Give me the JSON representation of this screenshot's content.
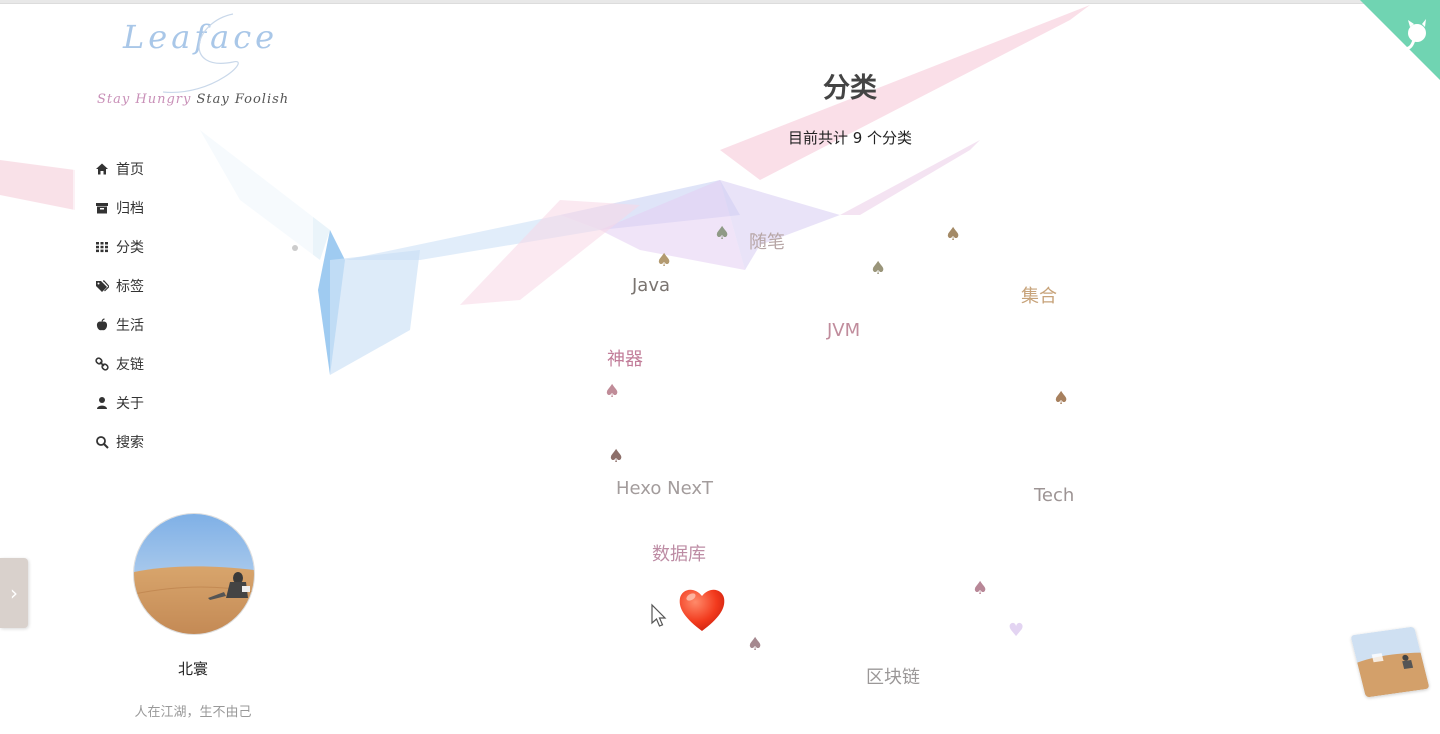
{
  "brand": {
    "title": "Leaface",
    "subtitle_pink": "Stay Hungry",
    "subtitle_dark": "Stay Foolish"
  },
  "menu": [
    {
      "label": "首页",
      "icon": "home-icon"
    },
    {
      "label": "归档",
      "icon": "archive-icon"
    },
    {
      "label": "分类",
      "icon": "th-grid-icon",
      "active": true
    },
    {
      "label": "标签",
      "icon": "tags-icon"
    },
    {
      "label": "生活",
      "icon": "apple-icon"
    },
    {
      "label": "友链",
      "icon": "link-icon"
    },
    {
      "label": "关于",
      "icon": "user-icon"
    },
    {
      "label": "搜索",
      "icon": "search-icon"
    }
  ],
  "profile": {
    "name": "北寰",
    "motto": "人在江湖，生不由己"
  },
  "page": {
    "title": "分类",
    "count_text": "目前共计 9 个分类"
  },
  "categories": [
    {
      "name": "随笔",
      "color": "#b7a6a6"
    },
    {
      "name": "Java",
      "color": "#7a7470"
    },
    {
      "name": "集合",
      "color": "#c7a37a"
    },
    {
      "name": "JVM",
      "color": "#c08c9c"
    },
    {
      "name": "神器",
      "color": "#c27e9a"
    },
    {
      "name": "Hexo NexT",
      "color": "#a39c9c"
    },
    {
      "name": "Tech",
      "color": "#9d9494"
    },
    {
      "name": "数据库",
      "color": "#bd8ca4"
    },
    {
      "name": "区块链",
      "color": "#9b9898"
    }
  ],
  "colors": {
    "github_corner": "#70d4b2",
    "side_toggle": "#d9d1cc"
  },
  "icons": {
    "github": "github-octocat-icon",
    "toggle": "chevron-right-icon",
    "heart": "heart-emoji-icon",
    "suit": "spade-icon"
  }
}
